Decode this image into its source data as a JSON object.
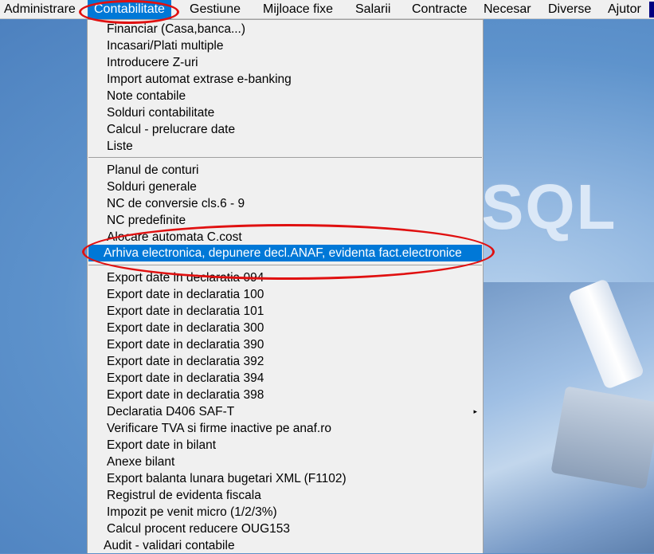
{
  "menubar": {
    "items": [
      {
        "label": "Administrare"
      },
      {
        "label": "Contabilitate"
      },
      {
        "label": "Gestiune"
      },
      {
        "label": "Mijloace fixe"
      },
      {
        "label": "Salarii"
      },
      {
        "label": "Contracte"
      },
      {
        "label": "Necesar"
      },
      {
        "label": "Diverse"
      },
      {
        "label": "Ajutor"
      }
    ]
  },
  "background": {
    "logo_text": "SQL"
  },
  "dropdown": {
    "group1": [
      "Financiar (Casa,banca...)",
      "Incasari/Plati multiple",
      "Introducere Z-uri",
      "Import automat extrase e-banking",
      "Note contabile",
      "Solduri contabilitate",
      "Calcul - prelucrare date",
      "Liste"
    ],
    "group2": [
      "Planul de conturi",
      "Solduri generale",
      "NC de conversie cls.6 - 9",
      "NC predefinite",
      "Alocare automata C.cost",
      "Arhiva electronica, depunere decl.ANAF, evidenta fact.electronice"
    ],
    "group3": [
      "Export date in declaratia 094",
      "Export date in declaratia 100",
      "Export date in declaratia 101",
      "Export date in declaratia 300",
      "Export date in declaratia 390",
      "Export date in declaratia 392",
      "Export date in declaratia 394",
      "Export date in declaratia 398",
      "Declaratia D406 SAF-T",
      "Verificare TVA si firme inactive pe anaf.ro",
      "Export date in bilant",
      "Anexe bilant",
      "Export balanta lunara bugetari XML (F1102)",
      "Registrul de evidenta fiscala",
      "Impozit pe venit micro (1/2/3%)",
      "Calcul procent reducere OUG153",
      "Audit - validari contabile"
    ],
    "submenu_arrow": "▸"
  },
  "colors": {
    "highlight": "#0078d7",
    "annotation": "#e01010"
  }
}
